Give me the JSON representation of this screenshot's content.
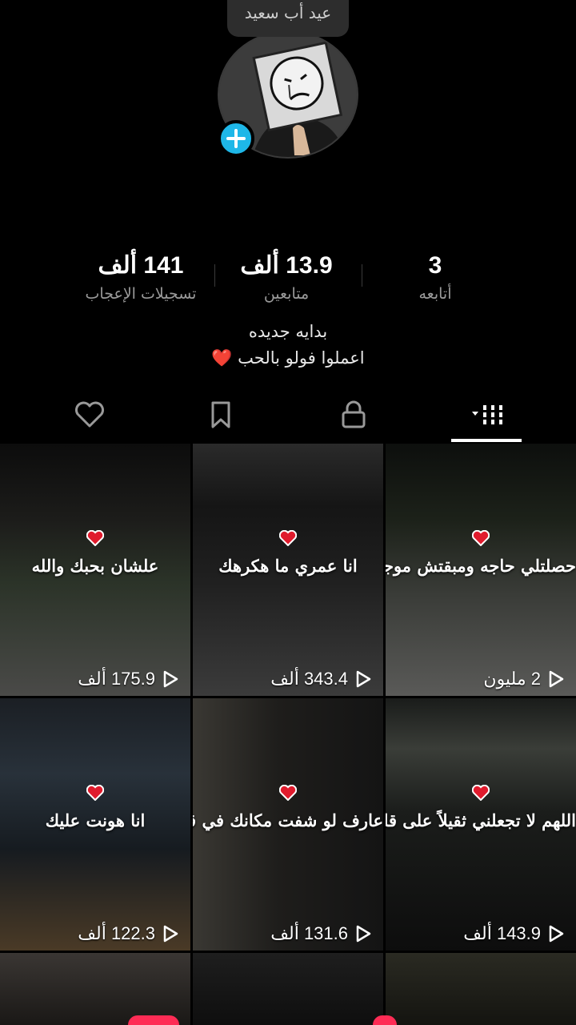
{
  "profile": {
    "name_tip": "عيد أب سعيد"
  },
  "stats": [
    {
      "value": "3",
      "label": "أتابعه"
    },
    {
      "value": "13.9 ألف",
      "label": "متابعين"
    },
    {
      "value": "141 ألف",
      "label": "تسجيلات الإعجاب"
    }
  ],
  "bio": {
    "line1": "بدايه جديده",
    "line2": "اعملوا فولو بالحب ❤️"
  },
  "tabs": {
    "videos_icon": "grid-icon",
    "private_icon": "lock-icon",
    "saved_icon": "bookmark-icon",
    "liked_icon": "heart-icon"
  },
  "videos": [
    {
      "caption": "حصلتلي حاجه ومبقتش موجود",
      "views": "2 مليون"
    },
    {
      "caption": "انا عمري ما هكرهك",
      "views": "343.4 ألف"
    },
    {
      "caption": "علشان بحبك والله",
      "views": "175.9 ألف"
    },
    {
      "caption": "اللهم لا تجعلني ثقيلاً على قلب أحد",
      "views": "143.9 ألف"
    },
    {
      "caption": "عارف لو شفت مكانك في قلبي",
      "views": "131.6 ألف"
    },
    {
      "caption": "انا هونت عليك",
      "views": "122.3 ألف"
    }
  ],
  "colors": {
    "accent": "#1eb7e8",
    "heart": "#e01b2d",
    "badge": "#fe2c55"
  }
}
